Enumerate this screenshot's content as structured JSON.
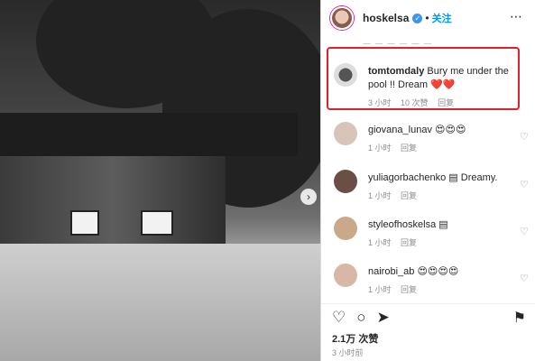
{
  "header": {
    "username": "hoskelsa",
    "dot": "•",
    "follow_label": "关注",
    "more_icon": "more-dots-icon",
    "cut_off": "一 一 一 一 一 一"
  },
  "comments": [
    {
      "username": "tomtomdaly",
      "text": "Bury me under the pool !! Dream",
      "emoji": "❤️❤️",
      "time": "3 小时",
      "likes": "10 次赞",
      "reply": "回复"
    },
    {
      "username": "giovana_lunav",
      "text": "😍😍😍",
      "time": "1 小时",
      "reply": "回复"
    },
    {
      "username": "yuliagorbachenko",
      "text": "▤ Dreamy.",
      "time": "1 小时",
      "reply": "回复"
    },
    {
      "username": "styleofhoskelsa",
      "text": "▤",
      "time": "1 小时",
      "reply": "回复"
    },
    {
      "username": "nairobi_ab",
      "text": "😍😍😍😍",
      "time": "1 小时",
      "reply": "回复"
    }
  ],
  "post": {
    "likes": "2.1万 次赞",
    "time_ago": "3 小时前"
  },
  "icons": {
    "carousel_next": "›",
    "heart": "♡",
    "comment": "○",
    "share": "➤",
    "bookmark": "⚑",
    "verified": "✓"
  }
}
